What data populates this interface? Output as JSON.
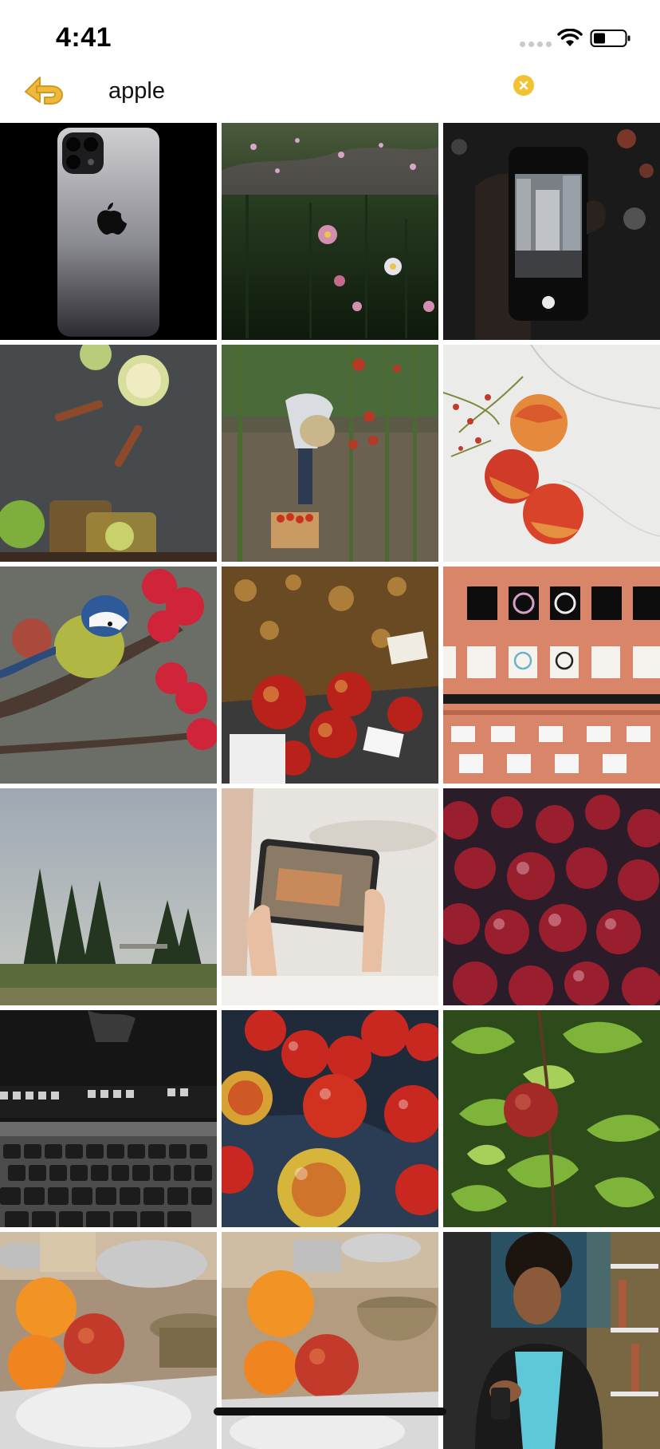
{
  "status_bar": {
    "time": "4:41",
    "icons": [
      "cellular-signal-icon",
      "wifi-icon",
      "battery-icon"
    ]
  },
  "search": {
    "query": "apple",
    "back_icon": "back-arrow-icon",
    "clear_icon": "clear-x-icon",
    "accent_color": "#f2c232"
  },
  "results": [
    {
      "id": "iphone-back"
    },
    {
      "id": "meadow-flowers"
    },
    {
      "id": "phone-camera-city"
    },
    {
      "id": "apple-cinnamon-tea"
    },
    {
      "id": "apple-picker-garden"
    },
    {
      "id": "apples-on-marble"
    },
    {
      "id": "bluetit-on-branch"
    },
    {
      "id": "market-apple-crate"
    },
    {
      "id": "apple-park-store-shelves"
    },
    {
      "id": "pine-trees-sky"
    },
    {
      "id": "tablet-ar-photo"
    },
    {
      "id": "pile-red-apples"
    },
    {
      "id": "macbook-keyboard"
    },
    {
      "id": "apples-in-water"
    },
    {
      "id": "apple-on-tree"
    },
    {
      "id": "oranges-apples-table"
    },
    {
      "id": "oranges-apple-pottery"
    },
    {
      "id": "man-with-phone"
    }
  ]
}
